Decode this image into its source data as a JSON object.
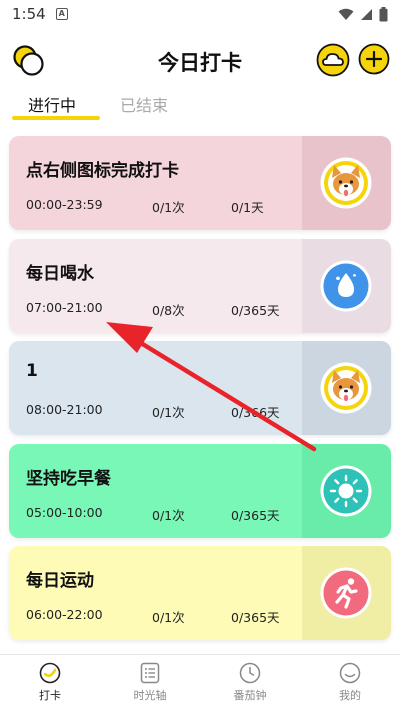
{
  "status_bar": {
    "time": "1:54",
    "badge": "A"
  },
  "header": {
    "title": "今日打卡"
  },
  "tabs": {
    "active": "进行中",
    "inactive": "已结束"
  },
  "colors": {
    "accent": "#f6d40b",
    "arrow": "#e8242a"
  },
  "cards": [
    {
      "title": "点右侧图标完成打卡",
      "time": "00:00-23:59",
      "count": "0/1次",
      "days": "0/1天",
      "icon": "dog-icon",
      "bg": "#f5d5dc",
      "side_bg": "#e9c3cc"
    },
    {
      "title": "每日喝水",
      "time": "07:00-21:00",
      "count": "0/8次",
      "days": "0/365天",
      "icon": "water-drop-icon",
      "bg": "#f5e9ee",
      "side_bg": "#e9dde3"
    },
    {
      "title": "1",
      "time": "08:00-21:00",
      "count": "0/1次",
      "days": "0/366天",
      "icon": "dog-icon",
      "bg": "#dae5ee",
      "side_bg": "#cbd6e0"
    },
    {
      "title": "坚持吃早餐",
      "time": "05:00-10:00",
      "count": "0/1次",
      "days": "0/365天",
      "icon": "sun-icon",
      "bg": "#78f7b7",
      "side_bg": "#69eba9"
    },
    {
      "title": "每日运动",
      "time": "06:00-22:00",
      "count": "0/1次",
      "days": "0/365天",
      "icon": "running-icon",
      "bg": "#fdfbb6",
      "side_bg": "#f0eea5"
    }
  ],
  "bottom_nav": [
    {
      "label": "打卡",
      "icon": "checkin-icon",
      "active": true
    },
    {
      "label": "时光轴",
      "icon": "timeline-icon",
      "active": false
    },
    {
      "label": "番茄钟",
      "icon": "clock-icon",
      "active": false
    },
    {
      "label": "我的",
      "icon": "profile-icon",
      "active": false
    }
  ]
}
